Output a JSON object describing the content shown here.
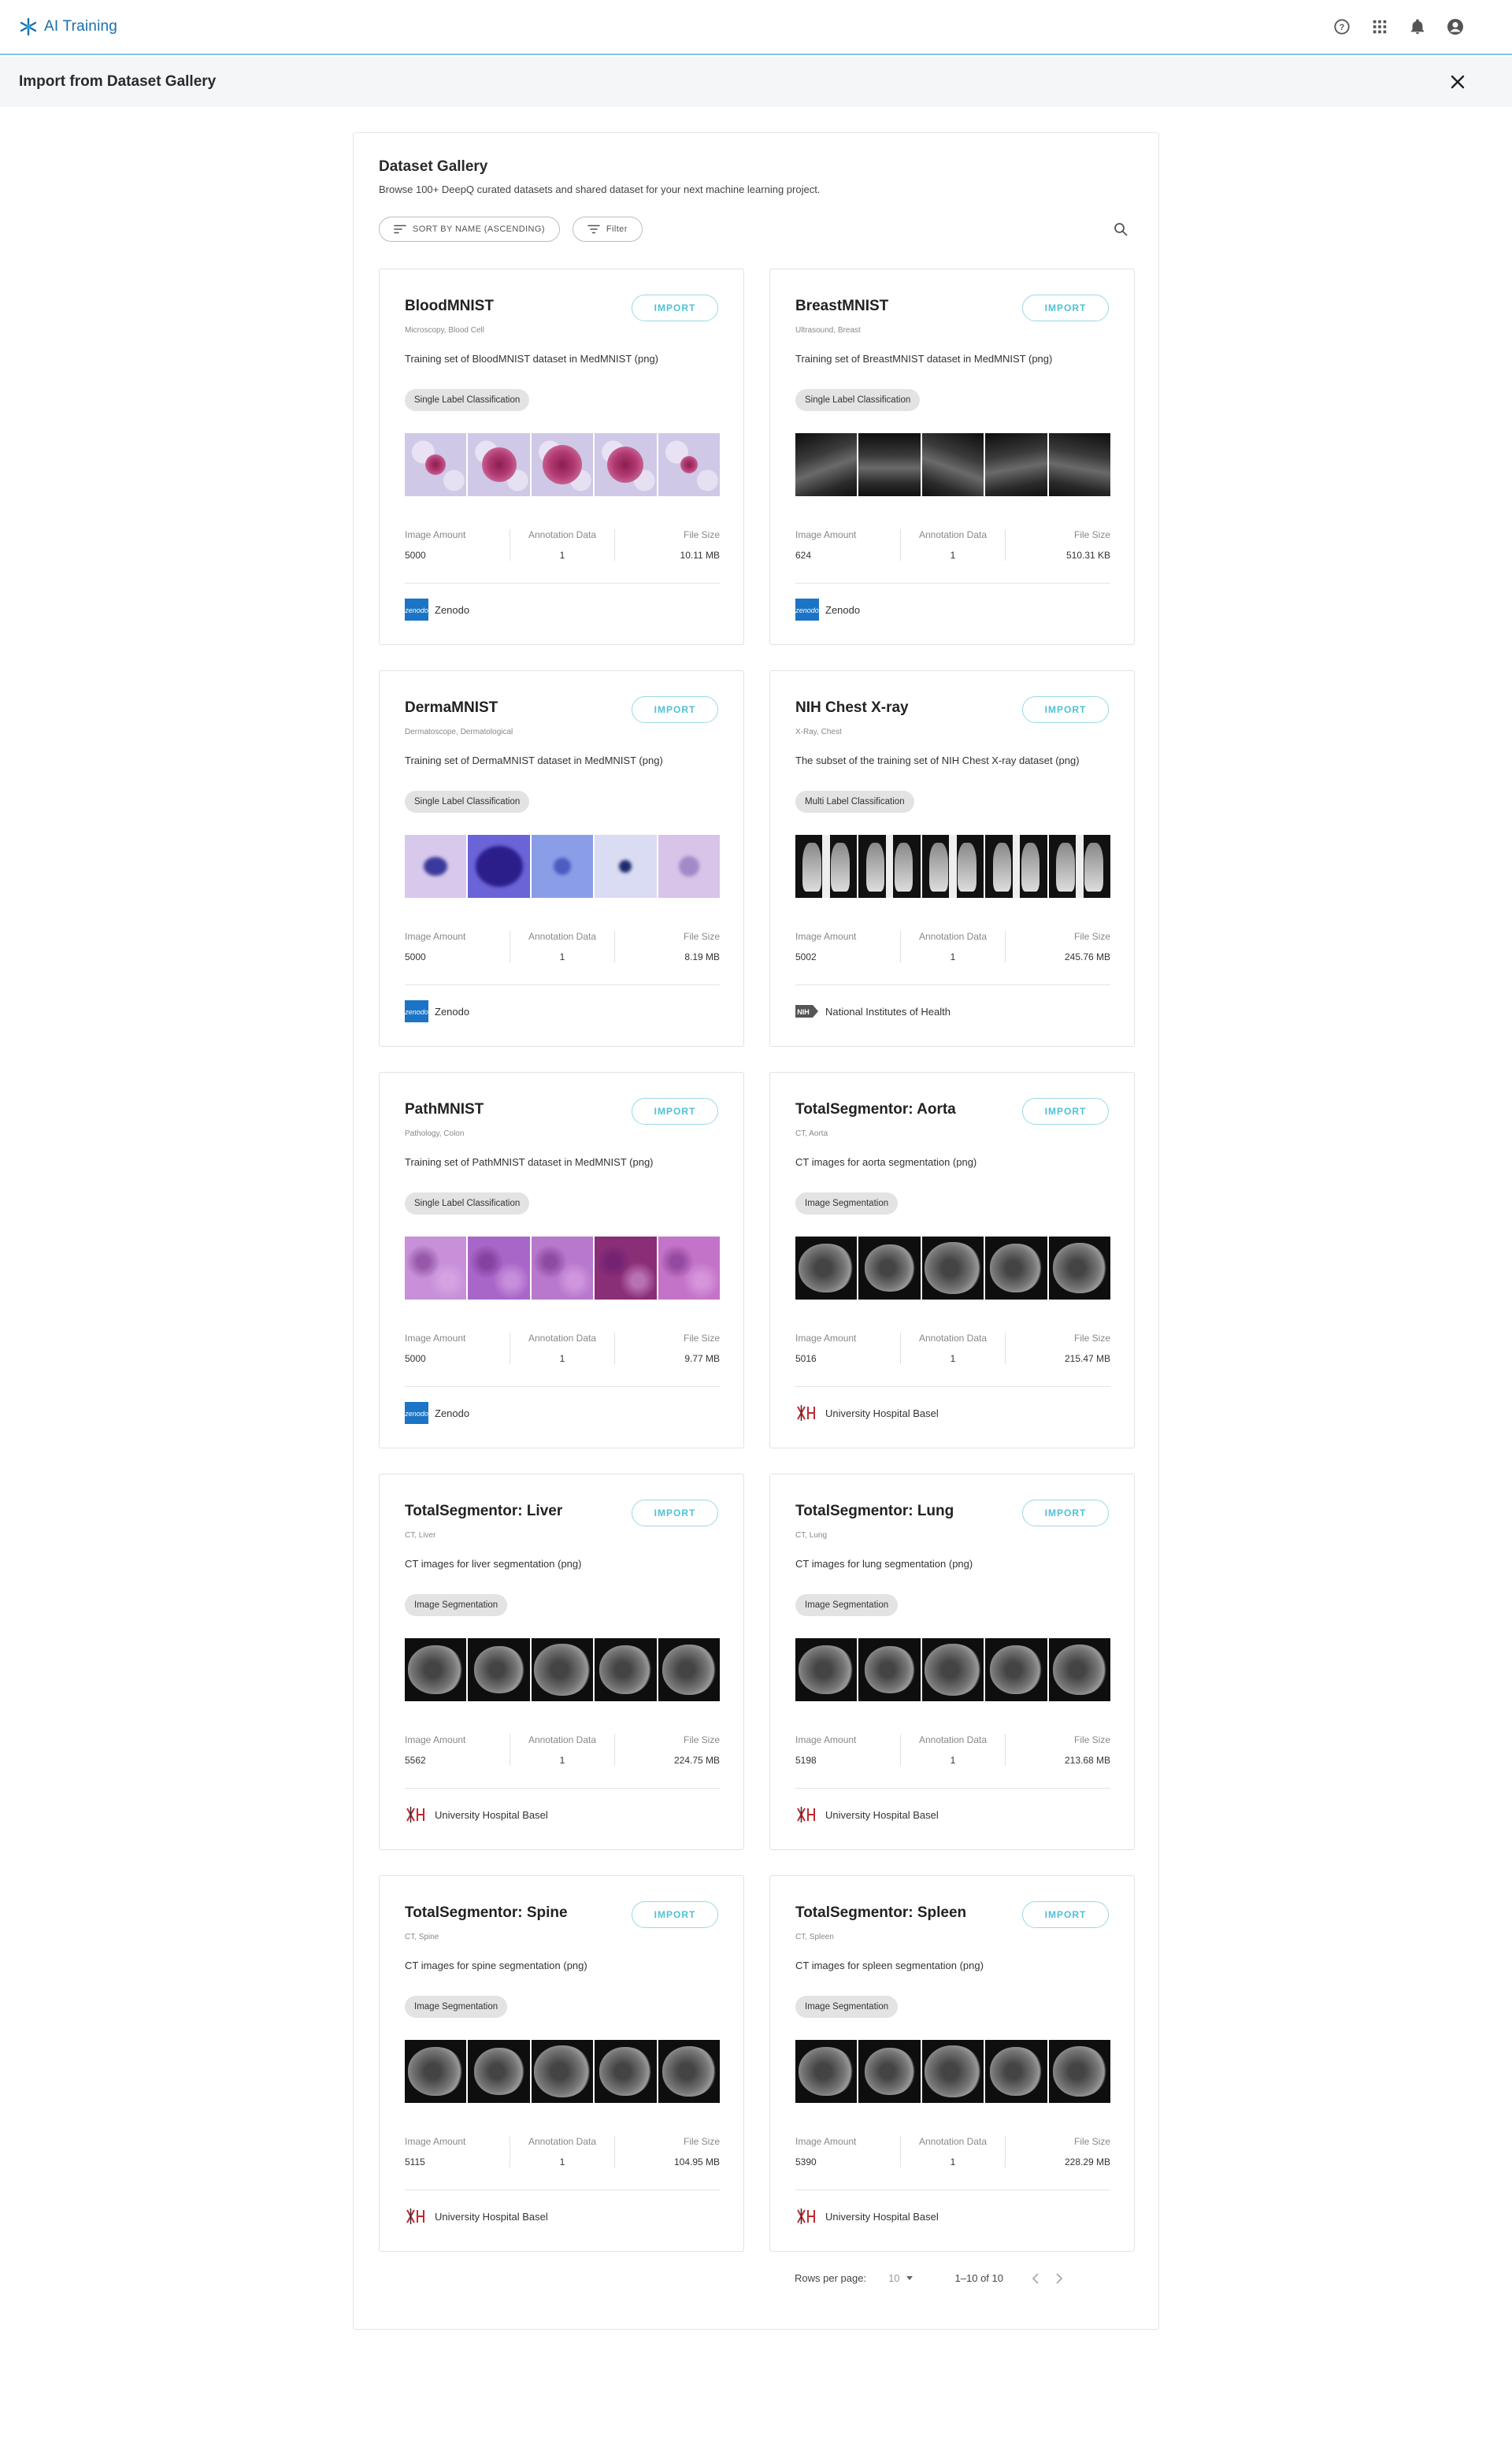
{
  "app": {
    "title": "AI Training"
  },
  "topbar": {
    "icons": [
      "help-circle-icon",
      "apps-grid-icon",
      "bell-icon",
      "account-circle-icon"
    ]
  },
  "page": {
    "title": "Import from Dataset Gallery"
  },
  "gallery": {
    "title": "Dataset Gallery",
    "description": "Browse 100+ DeepQ curated datasets and shared dataset for your next machine learning project.",
    "sort_label": "SORT BY NAME (ASCENDING)",
    "filter_label": "Filter"
  },
  "labels": {
    "import": "IMPORT",
    "image_amount": "Image Amount",
    "annotation_data": "Annotation Data",
    "file_size": "File Size"
  },
  "datasets": [
    {
      "name": "BloodMNIST",
      "meta": "Microscopy, Blood Cell",
      "description": "Training set of BloodMNIST dataset in MedMNIST (png)",
      "tag": "Single Label Classification",
      "image_amount": "5000",
      "annotation_data": "1",
      "file_size": "10.11 MB",
      "source": "Zenodo",
      "source_logo": "zenodo",
      "thumb_style": "blood"
    },
    {
      "name": "BreastMNIST",
      "meta": "Ultrasound, Breast",
      "description": "Training set of BreastMNIST dataset in MedMNIST (png)",
      "tag": "Single Label Classification",
      "image_amount": "624",
      "annotation_data": "1",
      "file_size": "510.31 KB",
      "source": "Zenodo",
      "source_logo": "zenodo",
      "thumb_style": "ultrasound"
    },
    {
      "name": "DermaMNIST",
      "meta": "Dermatoscope, Dermatological",
      "description": "Training set of DermaMNIST dataset in MedMNIST (png)",
      "tag": "Single Label Classification",
      "image_amount": "5000",
      "annotation_data": "1",
      "file_size": "8.19 MB",
      "source": "Zenodo",
      "source_logo": "zenodo",
      "thumb_style": "derma"
    },
    {
      "name": "NIH Chest X-ray",
      "meta": "X-Ray, Chest",
      "description": "The subset of the training set of NIH Chest X-ray dataset (png)",
      "tag": "Multi Label Classification",
      "image_amount": "5002",
      "annotation_data": "1",
      "file_size": "245.76 MB",
      "source": "National Institutes of Health",
      "source_logo": "nih",
      "thumb_style": "xray"
    },
    {
      "name": "PathMNIST",
      "meta": "Pathology, Colon",
      "description": "Training set of PathMNIST dataset in MedMNIST (png)",
      "tag": "Single Label Classification",
      "image_amount": "5000",
      "annotation_data": "1",
      "file_size": "9.77 MB",
      "source": "Zenodo",
      "source_logo": "zenodo",
      "thumb_style": "path"
    },
    {
      "name": "TotalSegmentor: Aorta",
      "meta": "CT, Aorta",
      "description": "CT images for aorta segmentation (png)",
      "tag": "Image Segmentation",
      "image_amount": "5016",
      "annotation_data": "1",
      "file_size": "215.47 MB",
      "source": "University Hospital Basel",
      "source_logo": "basel",
      "thumb_style": "ct"
    },
    {
      "name": "TotalSegmentor: Liver",
      "meta": "CT, Liver",
      "description": "CT images for liver segmentation (png)",
      "tag": "Image Segmentation",
      "image_amount": "5562",
      "annotation_data": "1",
      "file_size": "224.75 MB",
      "source": "University Hospital Basel",
      "source_logo": "basel",
      "thumb_style": "ct"
    },
    {
      "name": "TotalSegmentor: Lung",
      "meta": "CT, Lung",
      "description": "CT images for lung segmentation (png)",
      "tag": "Image Segmentation",
      "image_amount": "5198",
      "annotation_data": "1",
      "file_size": "213.68 MB",
      "source": "University Hospital Basel",
      "source_logo": "basel",
      "thumb_style": "ct"
    },
    {
      "name": "TotalSegmentor: Spine",
      "meta": "CT, Spine",
      "description": "CT images for spine segmentation (png)",
      "tag": "Image Segmentation",
      "image_amount": "5115",
      "annotation_data": "1",
      "file_size": "104.95 MB",
      "source": "University Hospital Basel",
      "source_logo": "basel",
      "thumb_style": "ct"
    },
    {
      "name": "TotalSegmentor: Spleen",
      "meta": "CT, Spleen",
      "description": "CT images for spleen segmentation (png)",
      "tag": "Image Segmentation",
      "image_amount": "5390",
      "annotation_data": "1",
      "file_size": "228.29 MB",
      "source": "University Hospital Basel",
      "source_logo": "basel",
      "thumb_style": "ct"
    }
  ],
  "pagination": {
    "rows_per_page_label": "Rows per page:",
    "rows_per_page": "10",
    "range": "1–10 of 10"
  },
  "colors": {
    "accent": "#4ec2d6",
    "brand": "#1a6fae",
    "topbar_border": "#7fc4e8"
  }
}
